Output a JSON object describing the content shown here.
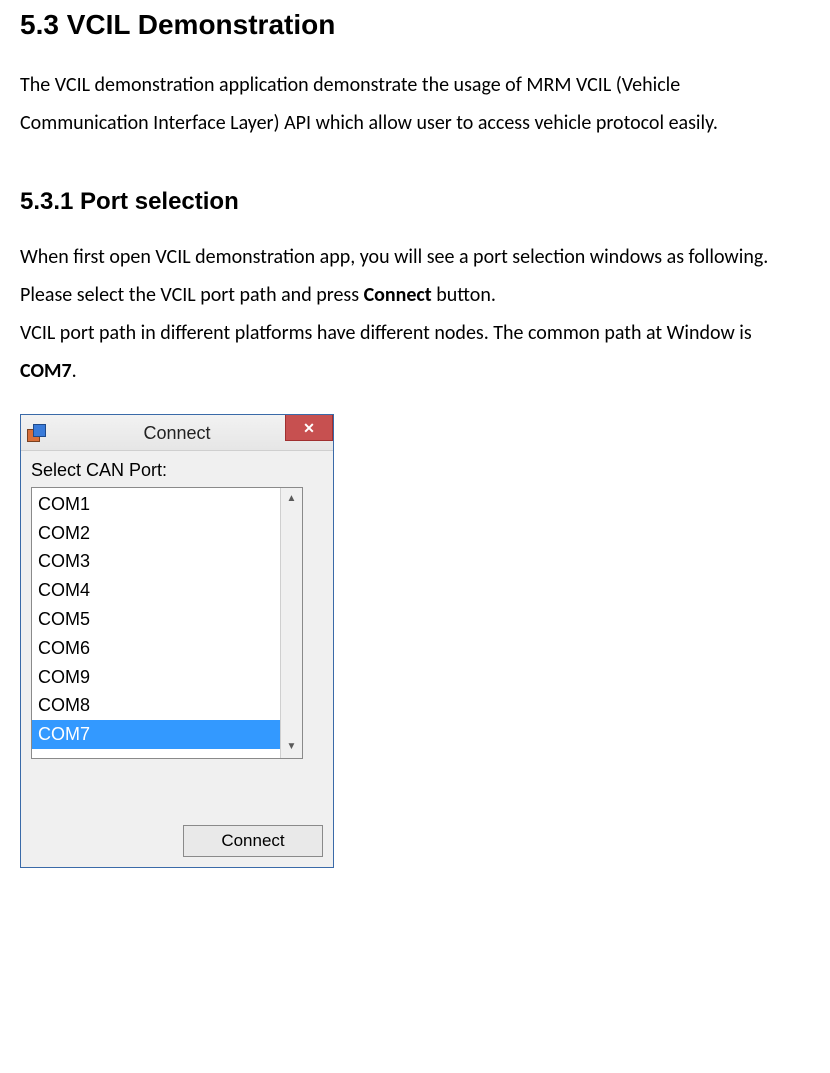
{
  "doc": {
    "section_heading": "5.3 VCIL Demonstration",
    "section_paragraph": "The VCIL demonstration application demonstrate the usage of MRM VCIL (Vehicle Communication Interface Layer) API which allow user to access vehicle protocol easily.",
    "subsection_heading": "5.3.1 Port selection",
    "sub_para1": "When first open VCIL demonstration app, you will see a port selection windows as following.",
    "sub_para2a": "Please select the VCIL port path and press ",
    "sub_para2_bold": "Connect",
    "sub_para2b": " button.",
    "sub_para3a": "VCIL port path in different platforms have different nodes. The common path at Window is ",
    "sub_para3_bold": "COM7",
    "sub_para3b": "."
  },
  "dialog": {
    "title": "Connect",
    "label": "Select CAN Port:",
    "ports": [
      "COM1",
      "COM2",
      "COM3",
      "COM4",
      "COM5",
      "COM6",
      "COM9",
      "COM8",
      "COM7"
    ],
    "selected_index": 8,
    "connect_button": "Connect"
  }
}
